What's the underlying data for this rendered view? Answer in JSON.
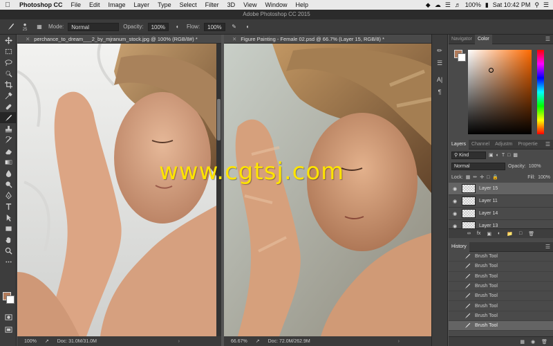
{
  "menubar": {
    "app": "Photoshop CC",
    "items": [
      "File",
      "Edit",
      "Image",
      "Layer",
      "Type",
      "Select",
      "Filter",
      "3D",
      "View",
      "Window",
      "Help"
    ],
    "battery": "100%",
    "clock": "Sat 10:42 PM"
  },
  "titlebar": {
    "title": "Adobe Photoshop CC 2015"
  },
  "options": {
    "brush_size": "25",
    "mode_label": "Mode:",
    "mode_value": "Normal",
    "opacity_label": "Opacity:",
    "opacity_value": "100%",
    "flow_label": "Flow:",
    "flow_value": "100%"
  },
  "doc1": {
    "tab": "perchance_to_dream___2_by_mjranum_stock.jpg @ 100% (RGB/8#) *",
    "zoom": "100%",
    "doc_size": "Doc: 31.0M/31.0M"
  },
  "doc2": {
    "tab": "Figure Painting - Female 02.psd @ 66.7% (Layer 15, RGB/8) *",
    "zoom": "66.67%",
    "doc_size": "Doc: 72.0M/262.9M"
  },
  "color_panel": {
    "tabs": [
      "Navigator",
      "Color"
    ],
    "fg_color": "#b07a5a"
  },
  "layers_panel": {
    "tabs": [
      "Layers",
      "Channel",
      "Adjustm",
      "Propertie"
    ],
    "filter": "Kind",
    "blend_mode": "Normal",
    "opacity_label": "Opacity:",
    "opacity_value": "100%",
    "lock_label": "Lock:",
    "fill_label": "Fill:",
    "fill_value": "100%",
    "layers": [
      {
        "name": "Layer 15",
        "selected": true
      },
      {
        "name": "Layer 11",
        "selected": false
      },
      {
        "name": "Layer 14",
        "selected": false
      },
      {
        "name": "Layer 13",
        "selected": false
      }
    ]
  },
  "history_panel": {
    "title": "History",
    "items": [
      "Brush Tool",
      "Brush Tool",
      "Brush Tool",
      "Brush Tool",
      "Brush Tool",
      "Brush Tool",
      "Brush Tool",
      "Brush Tool"
    ]
  },
  "watermark": "www.cgtsj.com"
}
